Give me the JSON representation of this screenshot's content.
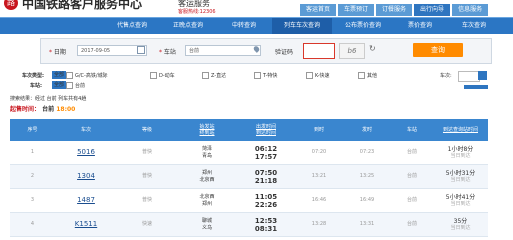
{
  "header": {
    "logo_glyph": "路",
    "title": "中国铁路客户服务中心",
    "subtitle": "客运服务",
    "hotline": "客服热线:12306"
  },
  "top_nav": [
    "客运首页",
    "车票预订",
    "订餐服务",
    "出行向导",
    "信息服务"
  ],
  "top_nav_active": 3,
  "sub_nav": [
    "代售点查询",
    "正晚点查询",
    "中转查询",
    "列车车次查询",
    "公布票价查询",
    "票价查询",
    "车次查询"
  ],
  "sub_nav_active": 3,
  "search": {
    "date_label": "日期",
    "date_value": "2017-09-05",
    "station_label": "车站",
    "station_value": "台前",
    "captcha_label": "验证码",
    "captcha_text": "b6",
    "query_button": "查询",
    "required_mark": "*"
  },
  "filters": {
    "type_label": "车次类型:",
    "type_all": "全部",
    "type_options": [
      "G/C-高铁/城际",
      "D-动车",
      "Z-直达",
      "T-特快",
      "K-快速",
      "其他"
    ],
    "station_label": "车站:",
    "station_all": "全部",
    "station_option": "台前",
    "train_no_label": "车次:"
  },
  "summary": {
    "text": "搜索结果：经过 台前 列车共有4趟",
    "start_time_label": "起售时间：",
    "station": "台前",
    "start_time": "18:00"
  },
  "table": {
    "headers": [
      {
        "l1": "序号",
        "l2": ""
      },
      {
        "l1": "车次",
        "l2": ""
      },
      {
        "l1": "等级",
        "l2": ""
      },
      {
        "l1": "始发站",
        "l2": "终到站"
      },
      {
        "l1": "出发时间",
        "l2": "到达时间"
      },
      {
        "l1": "到时",
        "l2": ""
      },
      {
        "l1": "发时",
        "l2": ""
      },
      {
        "l1": "车站",
        "l2": ""
      },
      {
        "l1": "到达查询站时间",
        "l2": ""
      }
    ],
    "rows": [
      {
        "idx": "1",
        "train": "5016",
        "grade": "普快",
        "from": "菏泽",
        "to": "青岛",
        "dep": "06:12",
        "arr": "17:57",
        "arrive": "07:20",
        "depart": "07:23",
        "station": "台前",
        "dur": "1小时8分",
        "day": "当日到达"
      },
      {
        "idx": "2",
        "train": "1304",
        "grade": "普快",
        "from": "郑州",
        "to": "北京西",
        "dep": "07:50",
        "arr": "21:18",
        "arrive": "13:21",
        "depart": "13:25",
        "station": "台前",
        "dur": "5小时31分",
        "day": "当日到达"
      },
      {
        "idx": "3",
        "train": "1487",
        "grade": "普快",
        "from": "北京西",
        "to": "郑州",
        "dep": "11:05",
        "arr": "22:26",
        "arrive": "16:46",
        "depart": "16:49",
        "station": "台前",
        "dur": "5小时41分",
        "day": "当日到达"
      },
      {
        "idx": "4",
        "train": "K1511",
        "grade": "快速",
        "from": "聊城",
        "to": "义乌",
        "dep": "12:53",
        "arr": "08:31",
        "arrive": "13:28",
        "depart": "13:31",
        "station": "台前",
        "dur": "35分",
        "day": "当日到达"
      }
    ]
  },
  "colors": {
    "brand_red": "#c8161e",
    "nav_blue": "#2b76c4",
    "query_orange": "#ff8b00",
    "header_blue": "#3a86cf"
  }
}
